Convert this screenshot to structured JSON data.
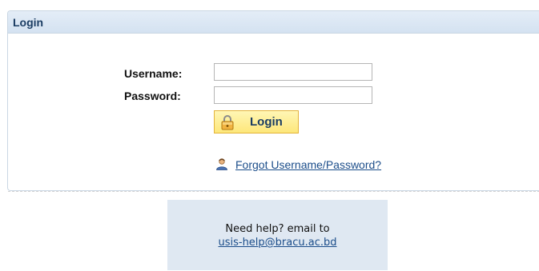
{
  "panel": {
    "title": "Login"
  },
  "form": {
    "username_label": "Username:",
    "username_value": "",
    "password_label": "Password:",
    "password_value": "",
    "login_button_label": "Login",
    "forgot_link": "Forgot Username/Password?"
  },
  "help": {
    "text": "Need help? email to",
    "email": "usis-help@bracu.ac.bd"
  },
  "icons": {
    "login_button_icon": "lock-icon",
    "forgot_icon": "user-icon"
  },
  "colors": {
    "header_bg": "#d4e2f1",
    "title_text": "#1b3d63",
    "button_bg": "#fde77a",
    "button_border": "#e3b33a",
    "link": "#1b4d8a",
    "help_bg": "#dfe8f2"
  }
}
